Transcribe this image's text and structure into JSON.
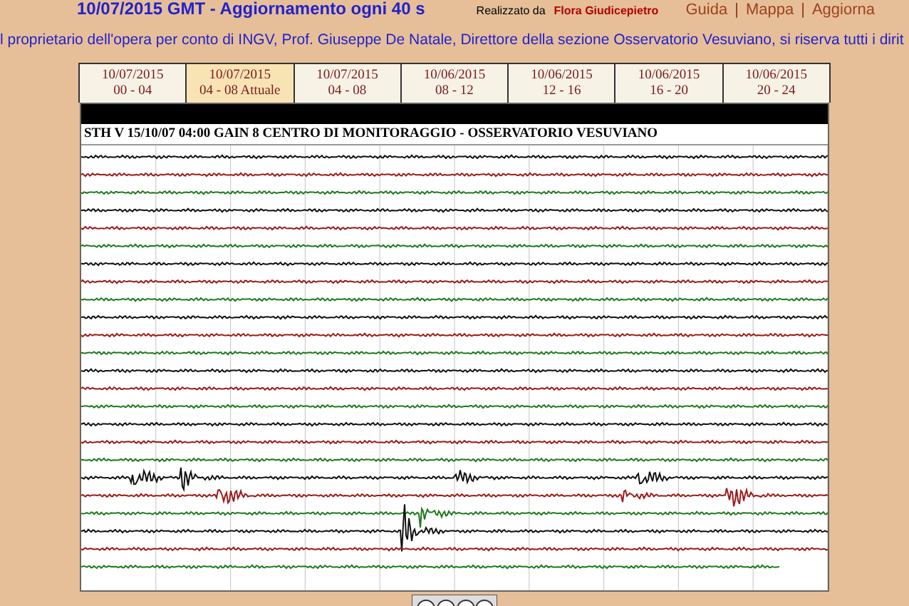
{
  "header": {
    "title": "10/07/2015 GMT - Aggiornamento ogni 40 s",
    "credit_label": "Realizzato da",
    "credit_name": "Flora Giudicepietro",
    "links": [
      "Guida",
      "Mappa",
      "Aggiorna"
    ],
    "separator": "|"
  },
  "notice": "l proprietario dell'opera per conto di INGV, Prof. Giuseppe De Natale, Direttore della sezione Osservatorio Vesuviano, si riserva tutti i dirit",
  "tabs": [
    {
      "date": "10/07/2015",
      "range": "00 - 04",
      "selected": false
    },
    {
      "date": "10/07/2015",
      "range": "04 - 08 Attuale",
      "selected": true
    },
    {
      "date": "10/07/2015",
      "range": "04 - 08",
      "selected": false
    },
    {
      "date": "10/06/2015",
      "range": "08 - 12",
      "selected": false
    },
    {
      "date": "10/06/2015",
      "range": "12 - 16",
      "selected": false
    },
    {
      "date": "10/06/2015",
      "range": "16 - 20",
      "selected": false
    },
    {
      "date": "10/06/2015",
      "range": "20 - 24",
      "selected": false
    }
  ],
  "plot": {
    "caption": "STH V 15/10/07 04:00 GAIN  8  CENTRO DI MONITORAGGIO - OSSERVATORIO VESUVIANO"
  }
}
